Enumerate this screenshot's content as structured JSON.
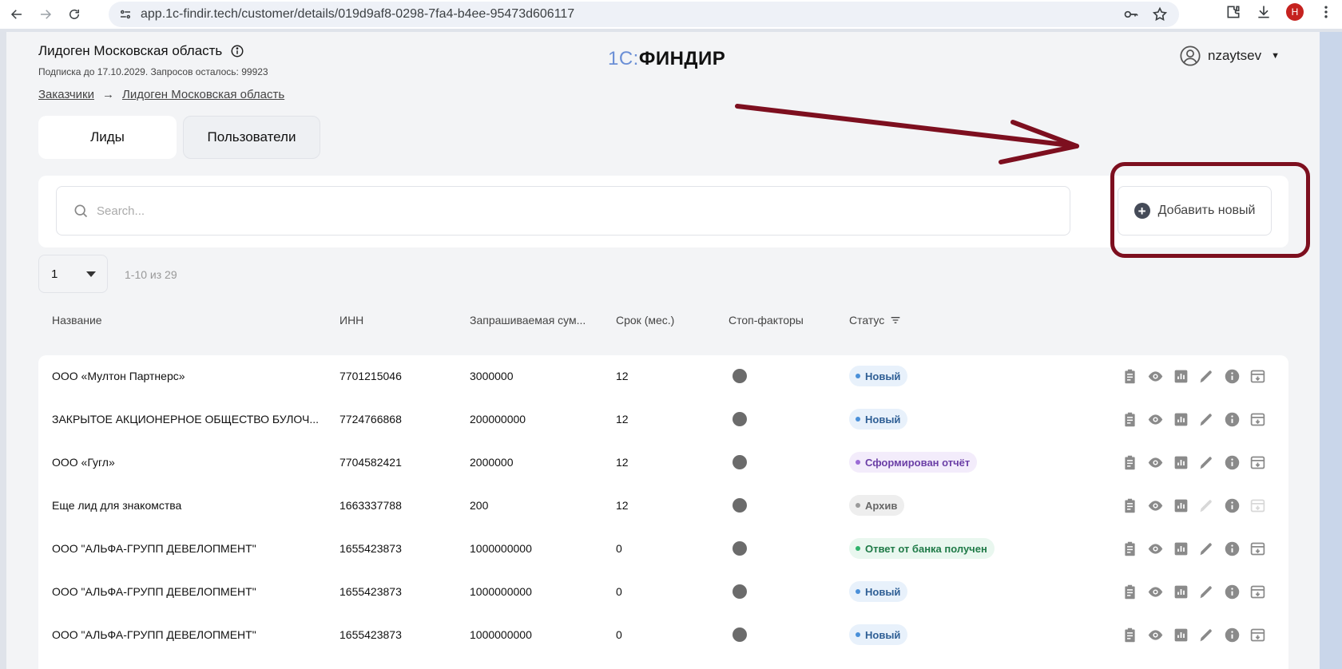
{
  "browser": {
    "url": "app.1c-findir.tech/customer/details/019d9af8-0298-7fa4-b4ee-95473d606117",
    "profile_initial": "H"
  },
  "header": {
    "company_title": "Лидоген Московская область",
    "subscription": "Подписка до 17.10.2029. Запросов осталось: 99923",
    "logo_prefix": "1С:",
    "logo_main": "ФИНДИР",
    "username": "nzaytsev"
  },
  "breadcrumb": {
    "root": "Заказчики",
    "separator": "→",
    "current": "Лидоген Московская область"
  },
  "tabs": [
    {
      "label": "Лиды",
      "active": true
    },
    {
      "label": "Пользователи",
      "active": false
    }
  ],
  "search": {
    "placeholder": "Search..."
  },
  "add_button": {
    "label": "Добавить новый"
  },
  "pagination": {
    "page": "1",
    "range": "1-10 из 29"
  },
  "table": {
    "columns": {
      "name": "Название",
      "inn": "ИНН",
      "amount": "Запрашиваемая сум...",
      "term": "Срок (мес.)",
      "stop": "Стоп-факторы",
      "status": "Статус"
    },
    "rows": [
      {
        "name": "ООО «Мултон Партнерс»",
        "inn": "7701215046",
        "amount": "3000000",
        "term": "12",
        "status": "Новый",
        "status_kind": "new",
        "edit_disabled": false
      },
      {
        "name": "ЗАКРЫТОЕ АКЦИОНЕРНОЕ ОБЩЕСТВО БУЛОЧ...",
        "inn": "7724766868",
        "amount": "200000000",
        "term": "12",
        "status": "Новый",
        "status_kind": "new",
        "edit_disabled": false
      },
      {
        "name": "ООО «Гугл»",
        "inn": "7704582421",
        "amount": "2000000",
        "term": "12",
        "status": "Сформирован отчёт",
        "status_kind": "report",
        "edit_disabled": false
      },
      {
        "name": "Еще лид для знакомства",
        "inn": "1663337788",
        "amount": "200",
        "term": "12",
        "status": "Архив",
        "status_kind": "archive",
        "edit_disabled": true
      },
      {
        "name": "ООО \"АЛЬФА-ГРУПП ДЕВЕЛОПМЕНТ\"",
        "inn": "1655423873",
        "amount": "1000000000",
        "term": "0",
        "status": "Ответ от банка получен",
        "status_kind": "bank",
        "edit_disabled": false
      },
      {
        "name": "ООО \"АЛЬФА-ГРУПП ДЕВЕЛОПМЕНТ\"",
        "inn": "1655423873",
        "amount": "1000000000",
        "term": "0",
        "status": "Новый",
        "status_kind": "new",
        "edit_disabled": false
      },
      {
        "name": "ООО \"АЛЬФА-ГРУПП ДЕВЕЛОПМЕНТ\"",
        "inn": "1655423873",
        "amount": "1000000000",
        "term": "0",
        "status": "Новый",
        "status_kind": "new",
        "edit_disabled": false
      }
    ]
  },
  "status_colors": {
    "new": {
      "bg": "#e8f1fb",
      "dot": "#4a90d9",
      "text": "#2f5f95"
    },
    "report": {
      "bg": "#f3ecfb",
      "dot": "#9b6bd6",
      "text": "#6b3fa6"
    },
    "archive": {
      "bg": "#eeeeee",
      "dot": "#9a9a9a",
      "text": "#666666"
    },
    "bank": {
      "bg": "#e9f7ef",
      "dot": "#2fb36b",
      "text": "#1f7a47"
    }
  },
  "annotation_color": "#7d0f1f",
  "action_icons": [
    "clipboard-icon",
    "eye-icon",
    "chart-icon",
    "pencil-icon",
    "info-icon",
    "archive-box-icon"
  ]
}
